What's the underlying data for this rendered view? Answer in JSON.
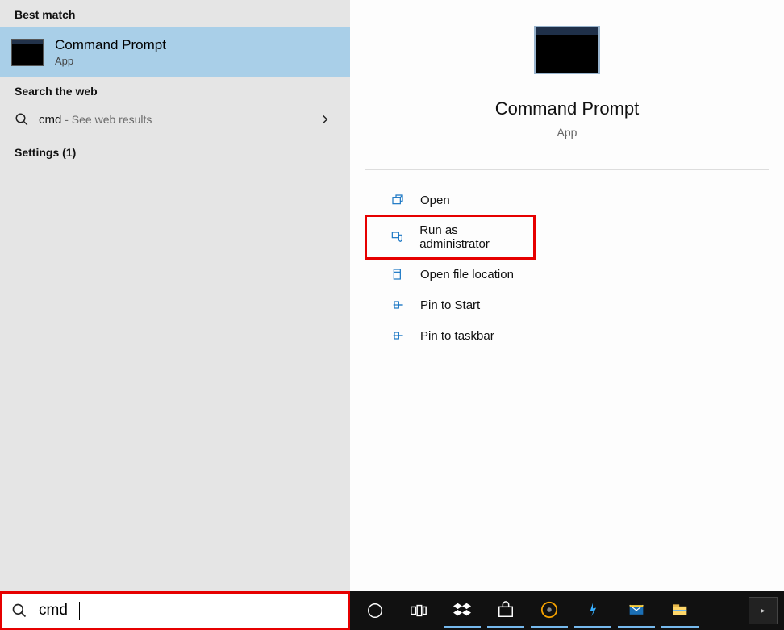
{
  "left": {
    "best_match_label": "Best match",
    "best_match": {
      "title": "Command Prompt",
      "sub": "App"
    },
    "search_web_label": "Search the web",
    "web_result": {
      "query": "cmd",
      "suffix": " - See web results"
    },
    "settings_label": "Settings (1)"
  },
  "right": {
    "title": "Command Prompt",
    "sub": "App",
    "actions": {
      "open": "Open",
      "run_admin": "Run as administrator",
      "open_loc": "Open file location",
      "pin_start": "Pin to Start",
      "pin_taskbar": "Pin to taskbar"
    }
  },
  "taskbar": {
    "search_value": "cmd"
  }
}
